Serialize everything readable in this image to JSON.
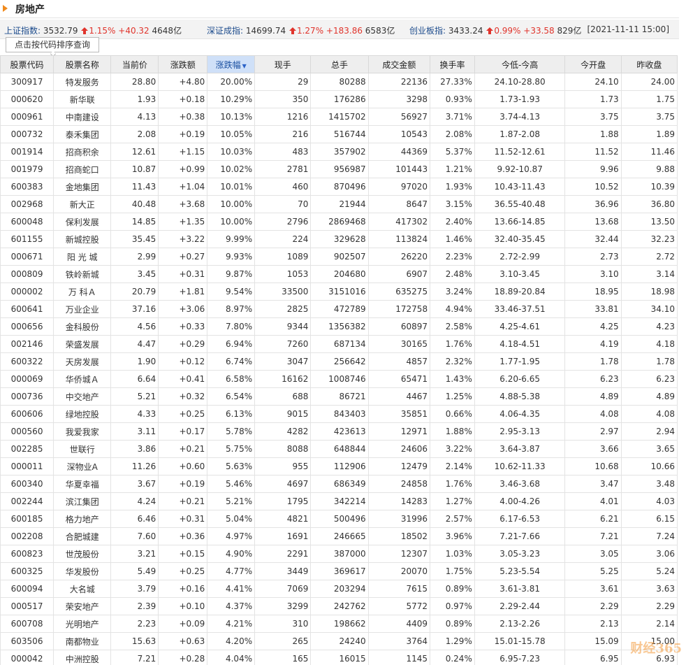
{
  "header": {
    "title": "房地产"
  },
  "indices": [
    {
      "label": "上证指数:",
      "value": "3532.79",
      "pct": "1.15%",
      "change": "+40.32",
      "amount": "4648亿"
    },
    {
      "label": "深证成指:",
      "value": "14699.74",
      "pct": "1.27%",
      "change": "+183.86",
      "amount": "6583亿"
    },
    {
      "label": "创业板指:",
      "value": "3433.24",
      "pct": "0.99%",
      "change": "+33.58",
      "amount": "829亿"
    }
  ],
  "datetime": "[2021-11-11 15:00]",
  "sort_button": {
    "label": "点击按代码排序查询"
  },
  "columns": [
    "股票代码",
    "股票名称",
    "当前价",
    "涨跌额",
    "涨跌幅",
    "现手",
    "总手",
    "成交金额",
    "换手率",
    "今低-今高",
    "今开盘",
    "昨收盘"
  ],
  "sorted_column_arrow": "▼",
  "rows": [
    [
      "300917",
      "特发服务",
      "28.80",
      "+4.80",
      "20.00%",
      "29",
      "80288",
      "22136",
      "27.33%",
      "24.10-28.80",
      "24.10",
      "24.00"
    ],
    [
      "000620",
      "新华联",
      "1.93",
      "+0.18",
      "10.29%",
      "350",
      "176286",
      "3298",
      "0.93%",
      "1.73-1.93",
      "1.73",
      "1.75"
    ],
    [
      "000961",
      "中南建设",
      "4.13",
      "+0.38",
      "10.13%",
      "1216",
      "1415702",
      "56927",
      "3.71%",
      "3.74-4.13",
      "3.75",
      "3.75"
    ],
    [
      "000732",
      "泰禾集团",
      "2.08",
      "+0.19",
      "10.05%",
      "216",
      "516744",
      "10543",
      "2.08%",
      "1.87-2.08",
      "1.88",
      "1.89"
    ],
    [
      "001914",
      "招商积余",
      "12.61",
      "+1.15",
      "10.03%",
      "483",
      "357902",
      "44369",
      "5.37%",
      "11.52-12.61",
      "11.52",
      "11.46"
    ],
    [
      "001979",
      "招商蛇口",
      "10.87",
      "+0.99",
      "10.02%",
      "2781",
      "956987",
      "101443",
      "1.21%",
      "9.92-10.87",
      "9.96",
      "9.88"
    ],
    [
      "600383",
      "金地集团",
      "11.43",
      "+1.04",
      "10.01%",
      "460",
      "870496",
      "97020",
      "1.93%",
      "10.43-11.43",
      "10.52",
      "10.39"
    ],
    [
      "002968",
      "新大正",
      "40.48",
      "+3.68",
      "10.00%",
      "70",
      "21944",
      "8647",
      "3.15%",
      "36.55-40.48",
      "36.96",
      "36.80"
    ],
    [
      "600048",
      "保利发展",
      "14.85",
      "+1.35",
      "10.00%",
      "2796",
      "2869468",
      "417302",
      "2.40%",
      "13.66-14.85",
      "13.68",
      "13.50"
    ],
    [
      "601155",
      "新城控股",
      "35.45",
      "+3.22",
      "9.99%",
      "224",
      "329628",
      "113824",
      "1.46%",
      "32.40-35.45",
      "32.44",
      "32.23"
    ],
    [
      "000671",
      "阳 光 城",
      "2.99",
      "+0.27",
      "9.93%",
      "1089",
      "902507",
      "26220",
      "2.23%",
      "2.72-2.99",
      "2.73",
      "2.72"
    ],
    [
      "000809",
      "铁岭新城",
      "3.45",
      "+0.31",
      "9.87%",
      "1053",
      "204680",
      "6907",
      "2.48%",
      "3.10-3.45",
      "3.10",
      "3.14"
    ],
    [
      "000002",
      "万 科Ａ",
      "20.79",
      "+1.81",
      "9.54%",
      "33500",
      "3151016",
      "635275",
      "3.24%",
      "18.89-20.84",
      "18.95",
      "18.98"
    ],
    [
      "600641",
      "万业企业",
      "37.16",
      "+3.06",
      "8.97%",
      "2825",
      "472789",
      "172758",
      "4.94%",
      "33.46-37.51",
      "33.81",
      "34.10"
    ],
    [
      "000656",
      "金科股份",
      "4.56",
      "+0.33",
      "7.80%",
      "9344",
      "1356382",
      "60897",
      "2.58%",
      "4.25-4.61",
      "4.25",
      "4.23"
    ],
    [
      "002146",
      "荣盛发展",
      "4.47",
      "+0.29",
      "6.94%",
      "7260",
      "687134",
      "30165",
      "1.76%",
      "4.18-4.51",
      "4.19",
      "4.18"
    ],
    [
      "600322",
      "天房发展",
      "1.90",
      "+0.12",
      "6.74%",
      "3047",
      "256642",
      "4857",
      "2.32%",
      "1.77-1.95",
      "1.78",
      "1.78"
    ],
    [
      "000069",
      "华侨城Ａ",
      "6.64",
      "+0.41",
      "6.58%",
      "16162",
      "1008746",
      "65471",
      "1.43%",
      "6.20-6.65",
      "6.23",
      "6.23"
    ],
    [
      "000736",
      "中交地产",
      "5.21",
      "+0.32",
      "6.54%",
      "688",
      "86721",
      "4467",
      "1.25%",
      "4.88-5.38",
      "4.89",
      "4.89"
    ],
    [
      "600606",
      "绿地控股",
      "4.33",
      "+0.25",
      "6.13%",
      "9015",
      "843403",
      "35851",
      "0.66%",
      "4.06-4.35",
      "4.08",
      "4.08"
    ],
    [
      "000560",
      "我爱我家",
      "3.11",
      "+0.17",
      "5.78%",
      "4282",
      "423613",
      "12971",
      "1.88%",
      "2.95-3.13",
      "2.97",
      "2.94"
    ],
    [
      "002285",
      "世联行",
      "3.86",
      "+0.21",
      "5.75%",
      "8088",
      "648844",
      "24606",
      "3.22%",
      "3.64-3.87",
      "3.66",
      "3.65"
    ],
    [
      "000011",
      "深物业A",
      "11.26",
      "+0.60",
      "5.63%",
      "955",
      "112906",
      "12479",
      "2.14%",
      "10.62-11.33",
      "10.68",
      "10.66"
    ],
    [
      "600340",
      "华夏幸福",
      "3.67",
      "+0.19",
      "5.46%",
      "4697",
      "686349",
      "24858",
      "1.76%",
      "3.46-3.68",
      "3.47",
      "3.48"
    ],
    [
      "002244",
      "滨江集团",
      "4.24",
      "+0.21",
      "5.21%",
      "1795",
      "342214",
      "14283",
      "1.27%",
      "4.00-4.26",
      "4.01",
      "4.03"
    ],
    [
      "600185",
      "格力地产",
      "6.46",
      "+0.31",
      "5.04%",
      "4821",
      "500496",
      "31996",
      "2.57%",
      "6.17-6.53",
      "6.21",
      "6.15"
    ],
    [
      "002208",
      "合肥城建",
      "7.60",
      "+0.36",
      "4.97%",
      "1691",
      "246665",
      "18502",
      "3.96%",
      "7.21-7.66",
      "7.21",
      "7.24"
    ],
    [
      "600823",
      "世茂股份",
      "3.21",
      "+0.15",
      "4.90%",
      "2291",
      "387000",
      "12307",
      "1.03%",
      "3.05-3.23",
      "3.05",
      "3.06"
    ],
    [
      "600325",
      "华发股份",
      "5.49",
      "+0.25",
      "4.77%",
      "3449",
      "369617",
      "20070",
      "1.75%",
      "5.23-5.54",
      "5.25",
      "5.24"
    ],
    [
      "600094",
      "大名城",
      "3.79",
      "+0.16",
      "4.41%",
      "7069",
      "203294",
      "7615",
      "0.89%",
      "3.61-3.81",
      "3.61",
      "3.63"
    ],
    [
      "000517",
      "荣安地产",
      "2.39",
      "+0.10",
      "4.37%",
      "3299",
      "242762",
      "5772",
      "0.97%",
      "2.29-2.44",
      "2.29",
      "2.29"
    ],
    [
      "600708",
      "光明地产",
      "2.23",
      "+0.09",
      "4.21%",
      "310",
      "198662",
      "4409",
      "0.89%",
      "2.13-2.26",
      "2.13",
      "2.14"
    ],
    [
      "603506",
      "南都物业",
      "15.63",
      "+0.63",
      "4.20%",
      "265",
      "24240",
      "3764",
      "1.29%",
      "15.01-15.78",
      "15.09",
      "15.00"
    ],
    [
      "000042",
      "中洲控股",
      "7.21",
      "+0.28",
      "4.04%",
      "165",
      "16015",
      "1145",
      "0.24%",
      "6.95-7.23",
      "6.95",
      "6.93"
    ]
  ],
  "watermark": "财经365",
  "colors": {
    "up": "#e0342c",
    "title_marker": "#f08a1c",
    "sorted_header_bg": "#cfe0f8",
    "link_blue": "#1c4b8c"
  }
}
